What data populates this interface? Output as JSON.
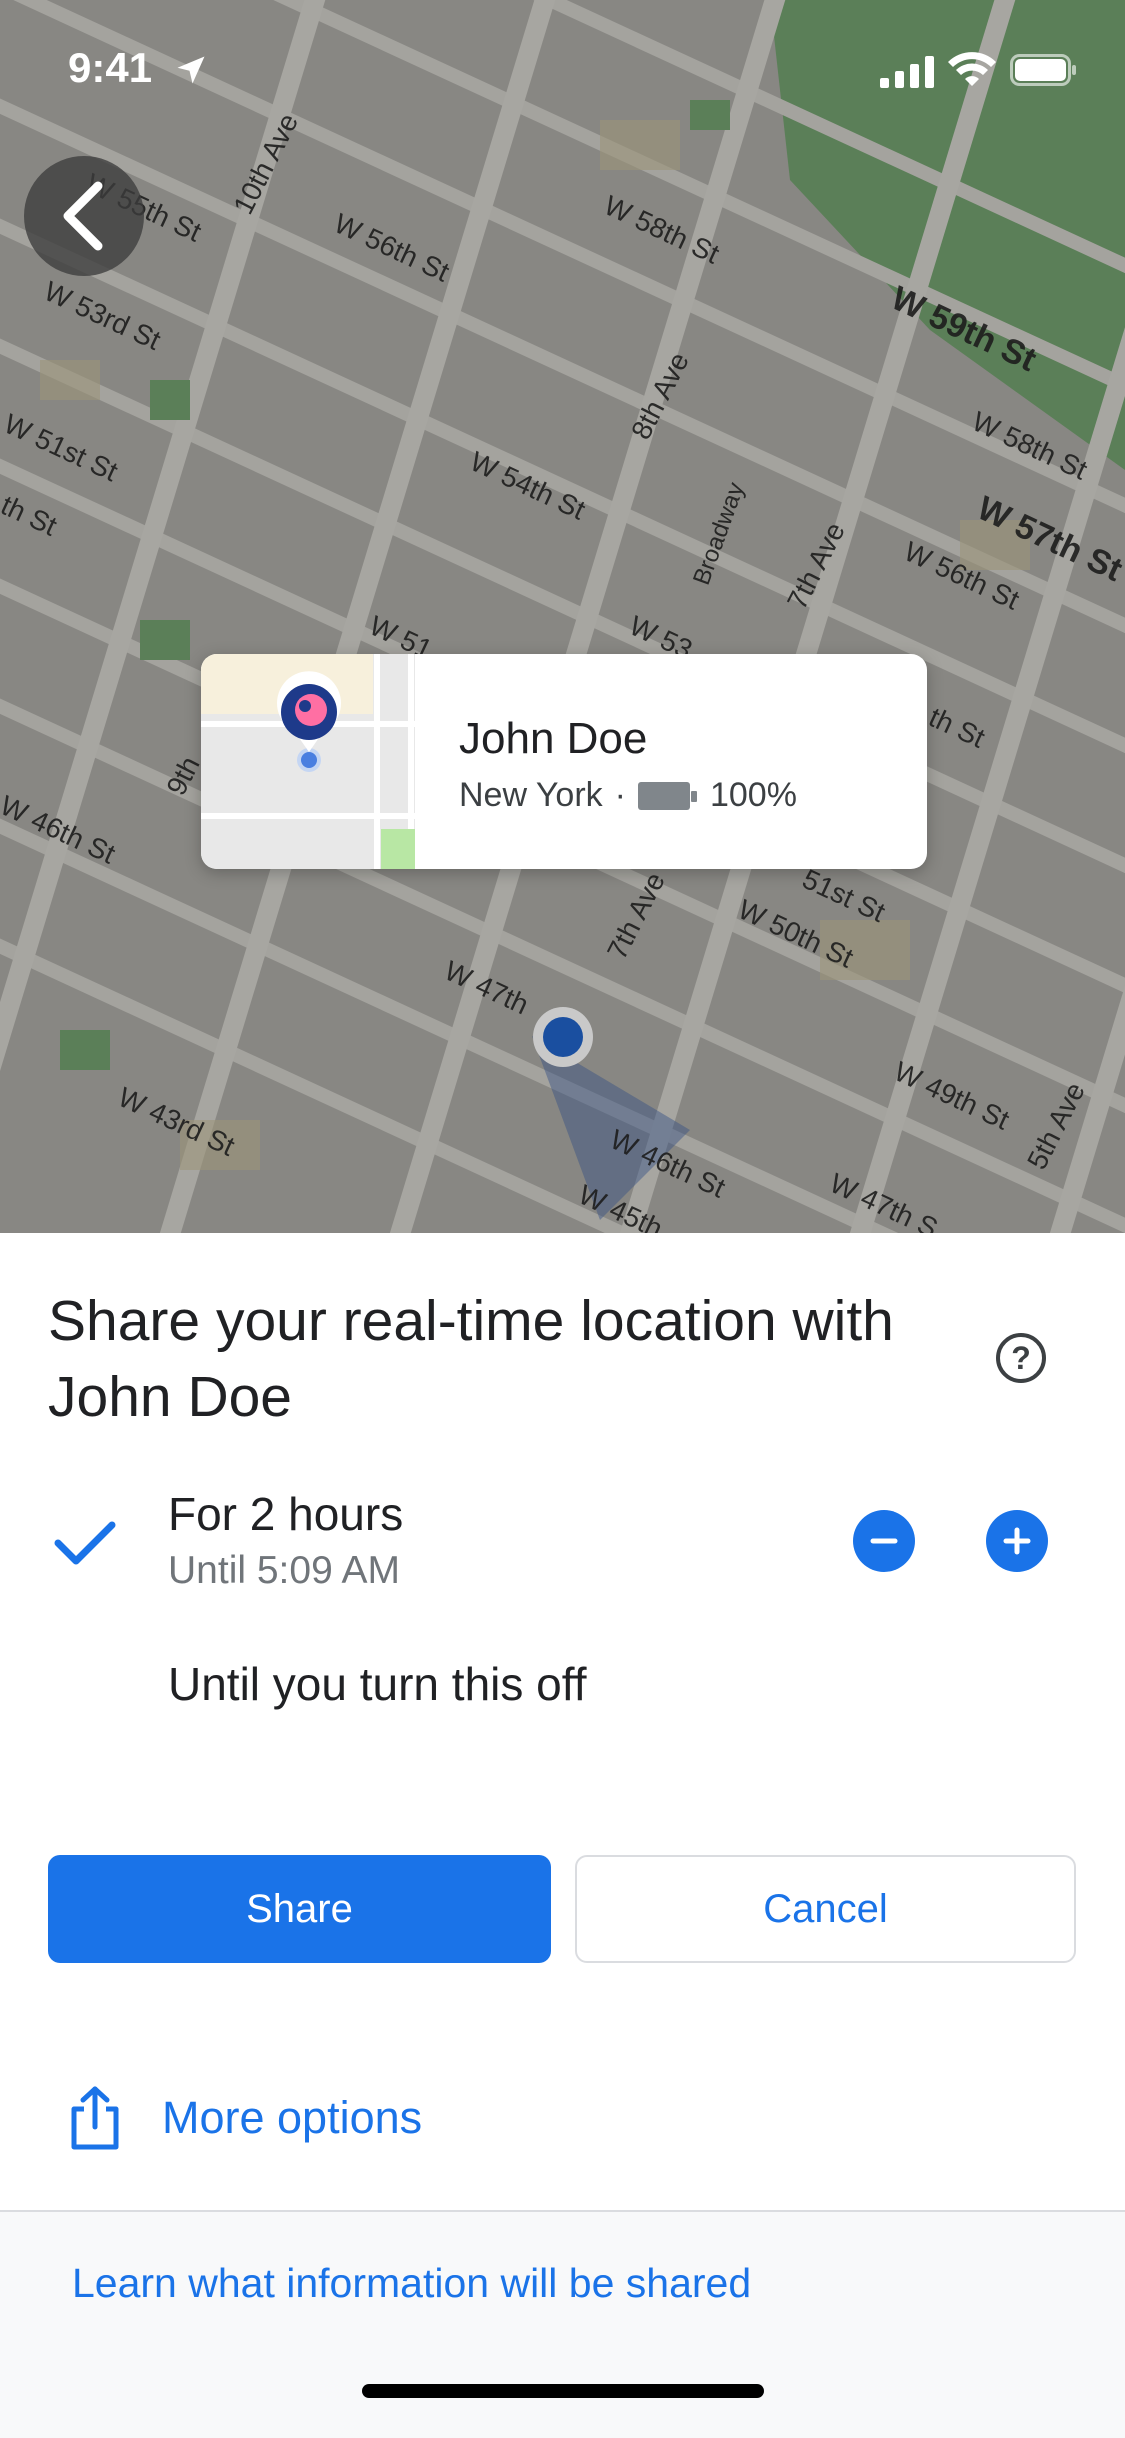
{
  "status_bar": {
    "time": "9:41"
  },
  "map": {
    "street_labels": [
      "W 55th St",
      "10th Ave",
      "W 56th St",
      "W 58th St",
      "W 59th St",
      "W 53rd St",
      "8th Ave",
      "W 51st St",
      "W 54th St",
      "Broadway",
      "7th Ave",
      "W 58th St",
      "W 57th St",
      "W 56th St",
      "W 46th St",
      "9th",
      "W 50th St",
      "W 47th",
      "7th Ave",
      "W 43rd St",
      "W 46th St",
      "W 49th St",
      "5th Ave",
      "W 47th S",
      "W 45th",
      "W 51",
      "W 53",
      "th St",
      "51st St",
      "th St"
    ]
  },
  "card": {
    "name": "John Doe",
    "city": "New York",
    "separator": "·",
    "battery": "100%"
  },
  "sheet": {
    "title": "Share your real-time location with John Doe",
    "help_icon": "?",
    "option1_title": "For 2 hours",
    "option1_subtitle": "Until 5:09 AM",
    "option2": "Until you turn this off",
    "share_label": "Share",
    "cancel_label": "Cancel",
    "more_options": "More options",
    "learn_link": "Learn what information will be shared"
  },
  "colors": {
    "accent": "#1a73e8",
    "text": "#202124",
    "secondary": "#70757a"
  },
  "icons": [
    "navigation-arrow-icon",
    "cellular-signal-icon",
    "wifi-icon",
    "battery-icon",
    "back-arrow-icon",
    "help-icon",
    "check-icon",
    "minus-icon",
    "plus-icon",
    "share-icon"
  ]
}
